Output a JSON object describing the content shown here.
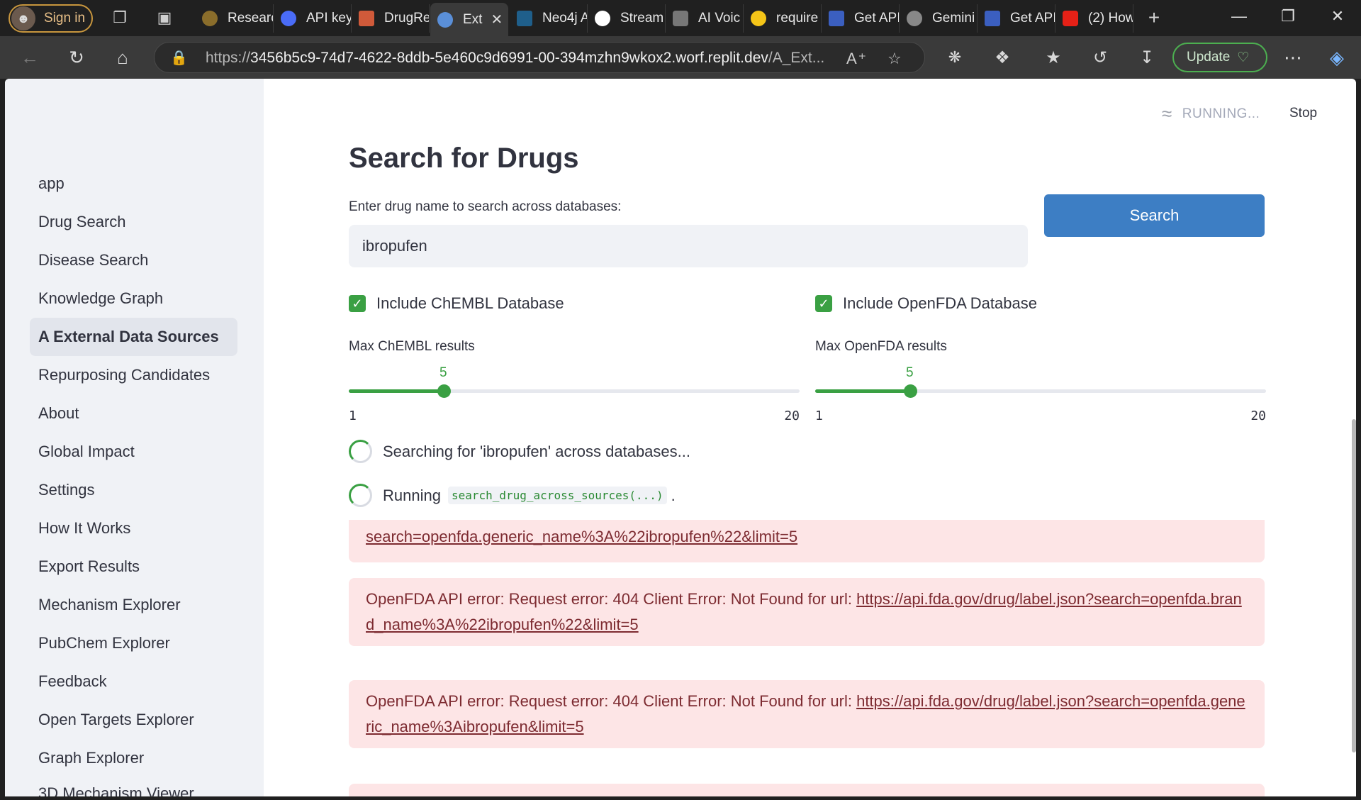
{
  "browser": {
    "signin_label": "Sign in",
    "tabs": [
      {
        "label": "Researc",
        "color": "#8a6d2b"
      },
      {
        "label": "API key",
        "color": "#4a6cf7"
      },
      {
        "label": "DrugRe",
        "color": "#d05a3a"
      },
      {
        "label": "Ext",
        "color": "#5a8fd8",
        "active": true
      },
      {
        "label": "Neo4j A",
        "color": "#1f5f8b"
      },
      {
        "label": "Stream",
        "color": "#ffffff"
      },
      {
        "label": "AI Voic",
        "color": "#777777"
      },
      {
        "label": "require",
        "color": "#f5c518"
      },
      {
        "label": "Get API",
        "color": "#3b5fc0"
      },
      {
        "label": "Gemini",
        "color": "#888888"
      },
      {
        "label": "Get API",
        "color": "#3b5fc0"
      },
      {
        "label": "(2) How",
        "color": "#e62117"
      }
    ],
    "url_prefix": "https://",
    "url_host": "3456b5c9-74d7-4622-8ddb-5e460c9d6991-00-394mzhn9wkox2.worf.replit.dev",
    "url_path": "/A_Ext...",
    "update_label": "Update"
  },
  "sidebar": {
    "items": [
      {
        "label": "app"
      },
      {
        "label": "Drug Search"
      },
      {
        "label": "Disease Search"
      },
      {
        "label": "Knowledge Graph"
      },
      {
        "label": "A External Data Sources",
        "active": true
      },
      {
        "label": "Repurposing Candidates"
      },
      {
        "label": "About"
      },
      {
        "label": "Global Impact"
      },
      {
        "label": "Settings"
      },
      {
        "label": "How It Works"
      },
      {
        "label": "Export Results"
      },
      {
        "label": "Mechanism Explorer"
      },
      {
        "label": "PubChem Explorer"
      },
      {
        "label": "Feedback"
      },
      {
        "label": "Open Targets Explorer"
      },
      {
        "label": "Graph Explorer"
      },
      {
        "label": "3D Mechanism Viewer"
      }
    ]
  },
  "status": {
    "running_label": "RUNNING...",
    "stop_label": "Stop"
  },
  "main": {
    "title": "Search for Drugs",
    "search_label": "Enter drug name to search across databases:",
    "search_value": "ibropufen",
    "search_button": "Search",
    "chembl_checkbox": "Include ChEMBL Database",
    "openfda_checkbox": "Include OpenFDA Database",
    "chembl_slider": {
      "label": "Max ChEMBL results",
      "value": 5,
      "min": 1,
      "max": 20
    },
    "openfda_slider": {
      "label": "Max OpenFDA results",
      "value": 5,
      "min": 1,
      "max": 20
    },
    "searching_text": "Searching for 'ibropufen' across databases...",
    "running_prefix": "Running",
    "running_code": "search_drug_across_sources(...)",
    "running_suffix": ".",
    "alerts": [
      {
        "text": "",
        "link": "search=openfda.generic_name%3A%22ibropufen%22&limit=5"
      },
      {
        "text": "OpenFDA API error: Request error: 404 Client Error: Not Found for url: ",
        "link": "https://api.fda.gov/drug/label.json?search=openfda.brand_name%3A%22ibropufen%22&limit=5"
      },
      {
        "text": "OpenFDA API error: Request error: 404 Client Error: Not Found for url: ",
        "link": "https://api.fda.gov/drug/label.json?search=openfda.generic_name%3Aibropufen&limit=5"
      }
    ]
  }
}
